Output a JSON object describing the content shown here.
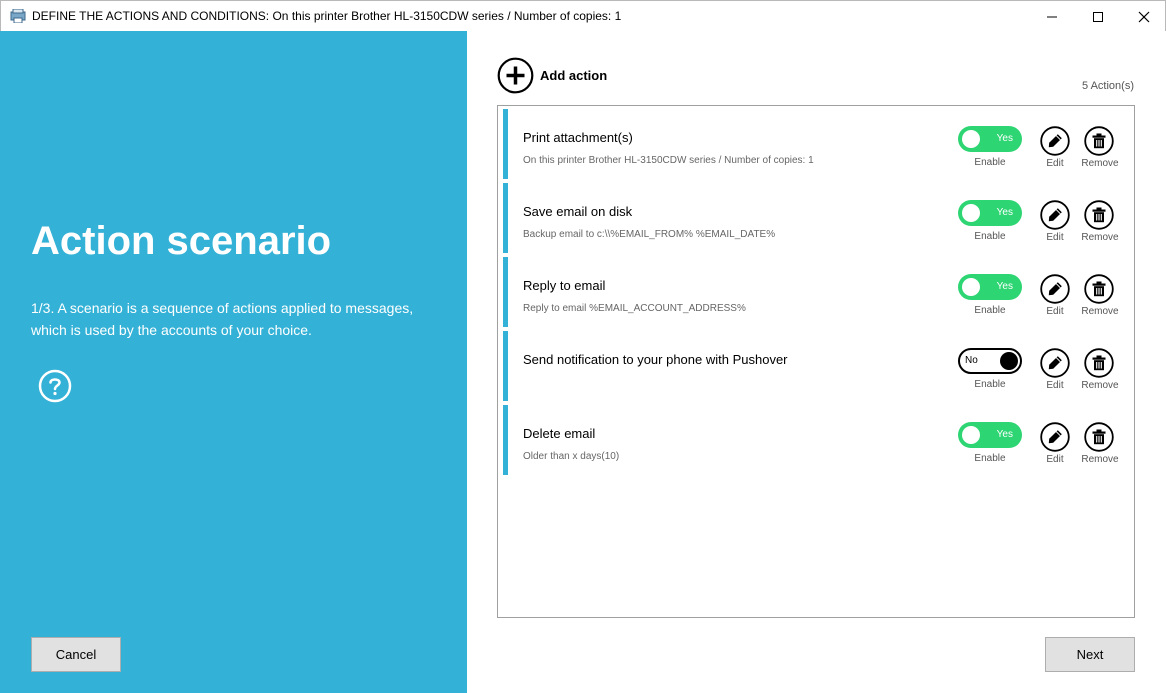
{
  "window": {
    "title": "DEFINE THE ACTIONS AND CONDITIONS: On this printer Brother HL-3150CDW series / Number of copies: 1"
  },
  "left_panel": {
    "heading": "Action scenario",
    "description": "1/3. A scenario is a sequence of actions applied to messages, which is used by the accounts of your choice.",
    "cancel_label": "Cancel",
    "accent_color": "#34b1d6"
  },
  "toolbar": {
    "add_action_label": "Add action",
    "action_count": "5  Action(s)"
  },
  "labels": {
    "enable": "Enable",
    "edit": "Edit",
    "remove": "Remove"
  },
  "actions": [
    {
      "title": "Print attachment(s)",
      "subtitle": "On this printer Brother HL-3150CDW series / Number of copies: 1",
      "enabled": true,
      "toggle_text": "Yes"
    },
    {
      "title": "Save email on disk",
      "subtitle": "Backup email to c:\\\\%EMAIL_FROM% %EMAIL_DATE%",
      "enabled": true,
      "toggle_text": "Yes"
    },
    {
      "title": "Reply to email",
      "subtitle": "Reply to email %EMAIL_ACCOUNT_ADDRESS%",
      "enabled": true,
      "toggle_text": "Yes"
    },
    {
      "title": "Send notification to your phone with Pushover",
      "subtitle": "",
      "enabled": false,
      "toggle_text": "No"
    },
    {
      "title": "Delete email",
      "subtitle": "Older than x days(10)",
      "enabled": true,
      "toggle_text": "Yes"
    }
  ],
  "footer": {
    "next_label": "Next"
  },
  "colors": {
    "toggle_on": "#2ed573",
    "panel": "#34b1d6"
  }
}
